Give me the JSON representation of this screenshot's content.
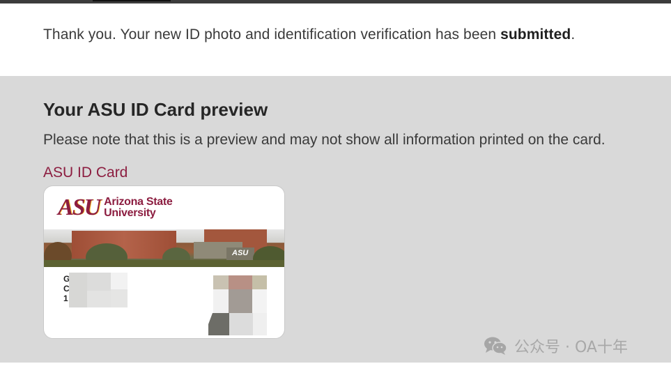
{
  "confirmation": {
    "prefix": "Thank you. Your new ID photo and identification verification has been ",
    "emphasis": "submitted",
    "suffix": "."
  },
  "preview": {
    "title": "Your ASU ID Card preview",
    "note": "Please note that this is a preview and may not show all information printed on the card.",
    "card_link": "ASU ID Card"
  },
  "card": {
    "logo_mark": "ASU",
    "logo_line1": "Arizona State",
    "logo_line2": "University",
    "sign_text": "ASU",
    "info_initials": [
      "G",
      "C",
      "1"
    ]
  },
  "colors": {
    "asu_maroon": "#8c1d40",
    "asu_gold": "#ffc627",
    "panel_gray": "#d9d9d9"
  },
  "watermark": "公众号 · OA十年"
}
